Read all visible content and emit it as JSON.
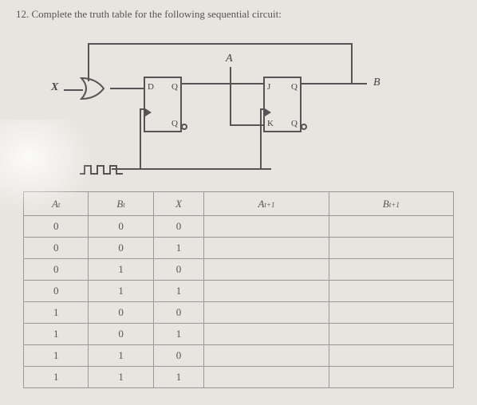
{
  "question": "12. Complete the truth table for the following sequential circuit:",
  "circuit": {
    "input_x": "X",
    "label_A": "A",
    "label_B": "B",
    "ff1": {
      "D": "D",
      "Q": "Q",
      "Qn": "Q"
    },
    "ff2": {
      "J": "J",
      "K": "K",
      "Q": "Q",
      "Qn": "Q"
    }
  },
  "table": {
    "headers": [
      {
        "main": "A",
        "sub": "t"
      },
      {
        "main": "B",
        "sub": "t"
      },
      {
        "main": "X",
        "sub": ""
      },
      {
        "main": "A",
        "sub": "t+1"
      },
      {
        "main": "B",
        "sub": "t+1"
      }
    ],
    "rows": [
      [
        "0",
        "0",
        "0",
        "",
        ""
      ],
      [
        "0",
        "0",
        "1",
        "",
        ""
      ],
      [
        "0",
        "1",
        "0",
        "",
        ""
      ],
      [
        "0",
        "1",
        "1",
        "",
        ""
      ],
      [
        "1",
        "0",
        "0",
        "",
        ""
      ],
      [
        "1",
        "0",
        "1",
        "",
        ""
      ],
      [
        "1",
        "1",
        "0",
        "",
        ""
      ],
      [
        "1",
        "1",
        "1",
        "",
        ""
      ]
    ]
  }
}
